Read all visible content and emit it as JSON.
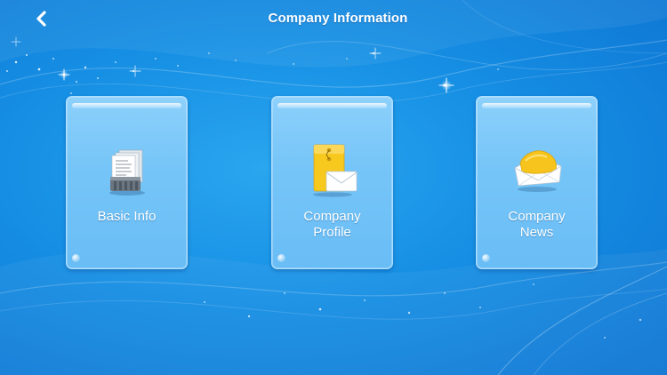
{
  "header": {
    "title": "Company Information",
    "back_icon": "chevron-left-icon"
  },
  "tiles": [
    {
      "label_lines": [
        "Basic Info"
      ],
      "icon": "documents-icon"
    },
    {
      "label_lines": [
        "Company",
        "Profile"
      ],
      "icon": "envelope-folder-icon"
    },
    {
      "label_lines": [
        "Company",
        "News"
      ],
      "icon": "open-envelope-icon"
    }
  ],
  "colors": {
    "background": "#168fe4",
    "tile": "#76c5f8",
    "text": "#ffffff",
    "envelope": "#f7c81e"
  }
}
